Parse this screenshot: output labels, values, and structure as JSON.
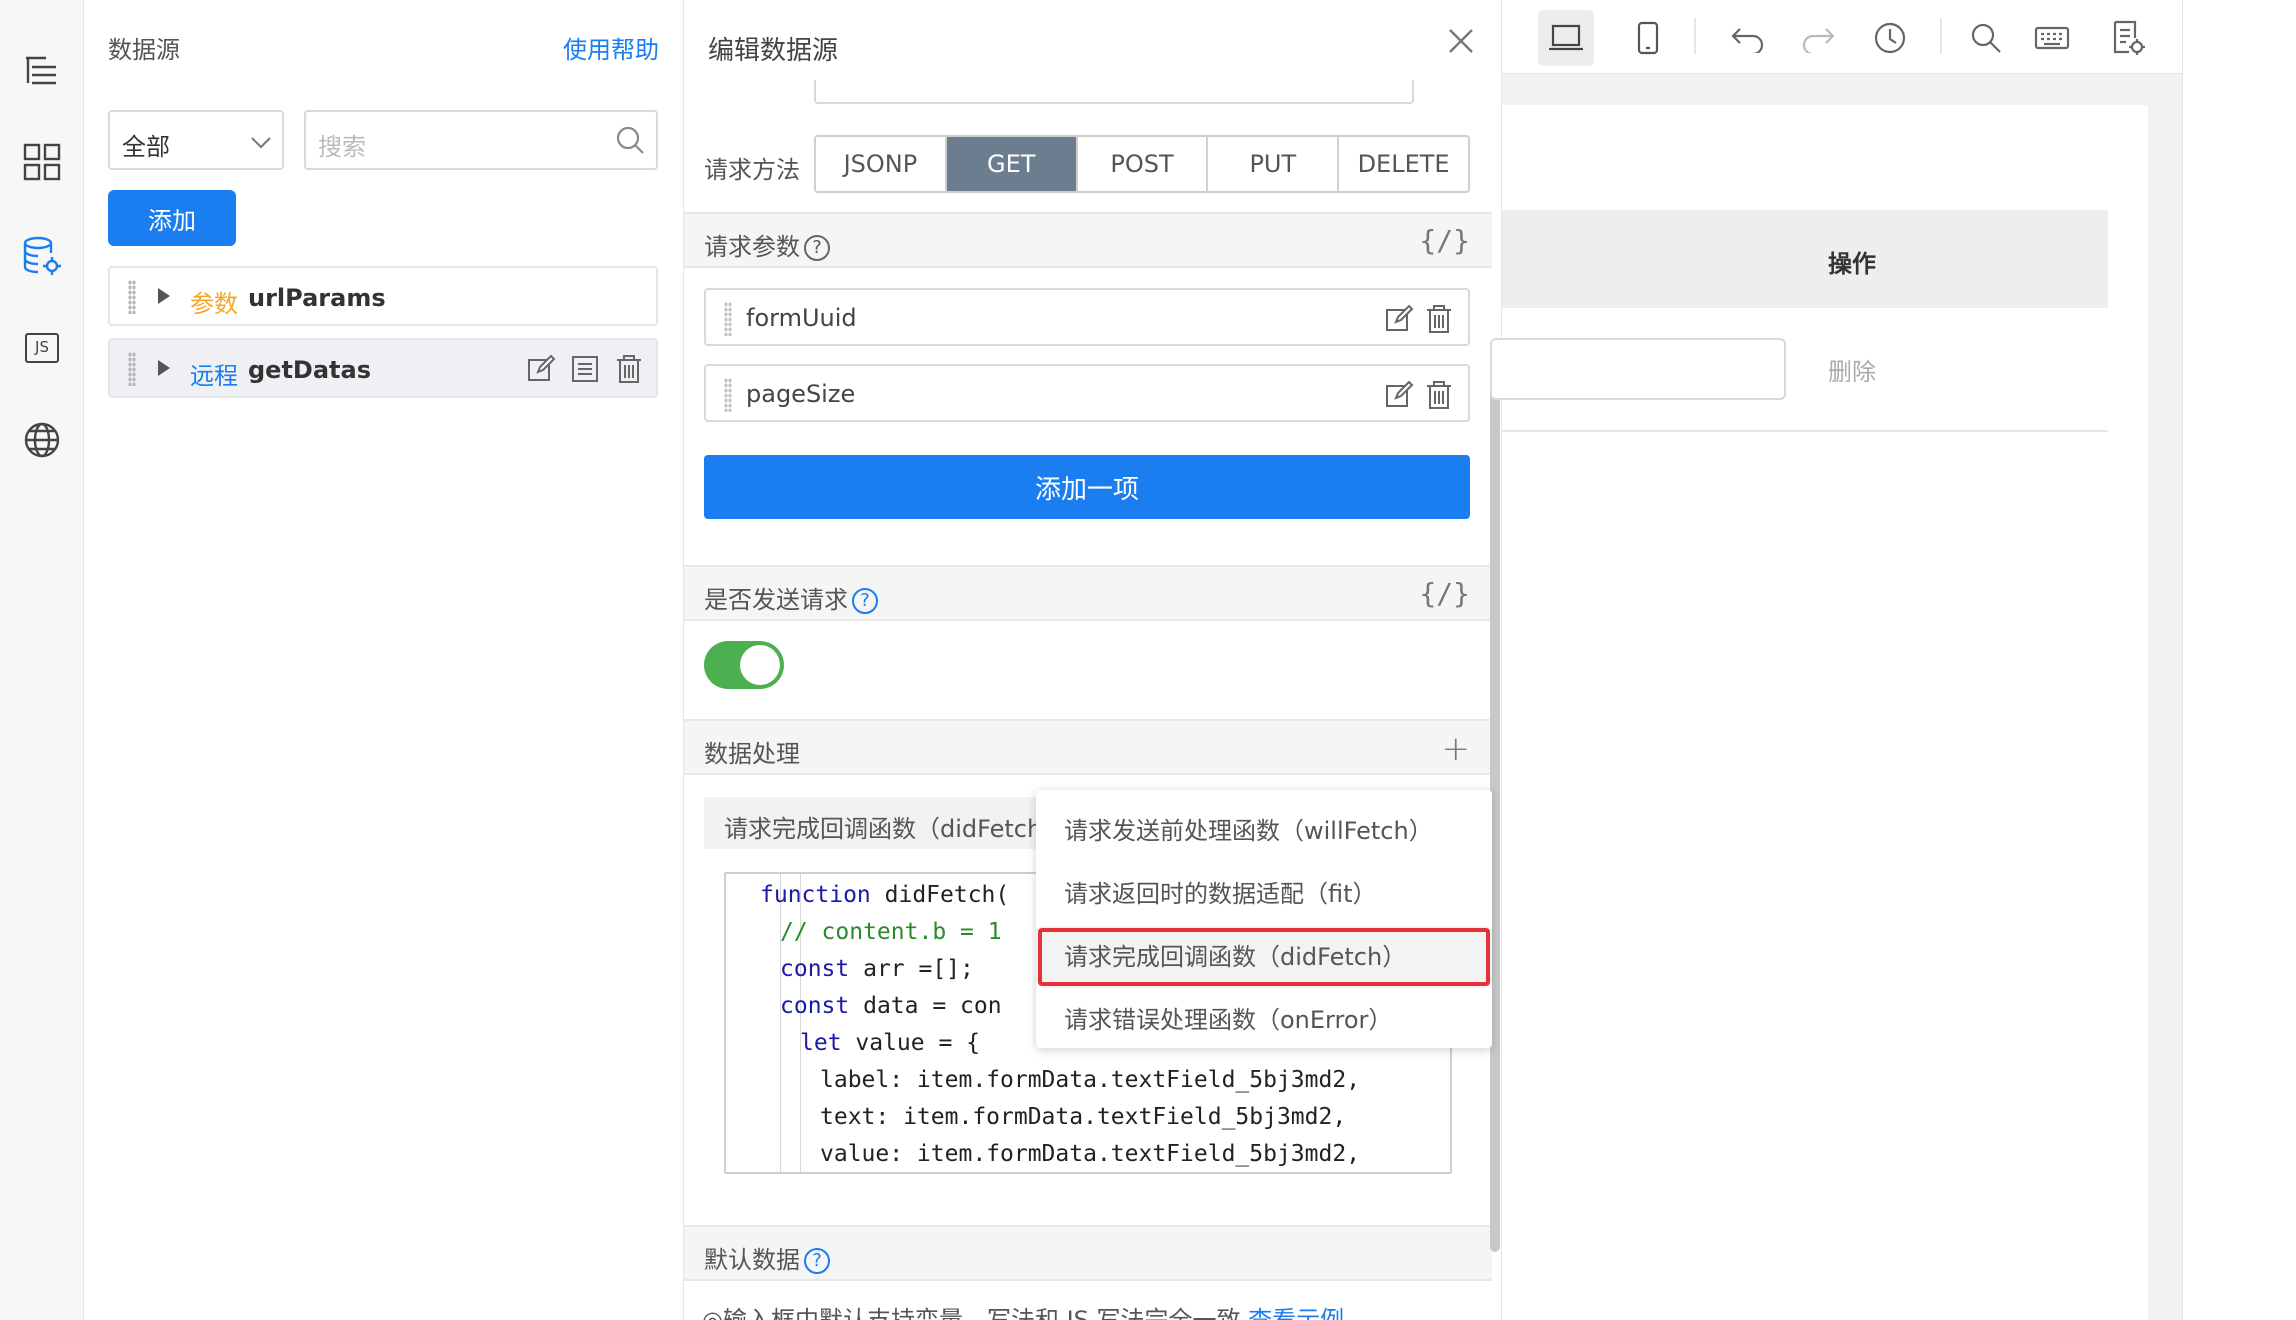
{
  "rail": {
    "icons": [
      "outline-icon",
      "components-icon",
      "datasource-icon",
      "js-icon",
      "globe-icon"
    ],
    "js_label": "JS"
  },
  "datasource": {
    "title": "数据源",
    "help_link": "使用帮助",
    "filter_value": "全部",
    "search_placeholder": "搜索",
    "add_button": "添加",
    "items": [
      {
        "kind": "参数",
        "name": "urlParams",
        "kind_color": "#f5a623"
      },
      {
        "kind": "远程",
        "name": "getDatas",
        "kind_color": "#1a7df0"
      }
    ]
  },
  "editor": {
    "title": "编辑数据源",
    "method_label": "请求方法",
    "methods": [
      "JSONP",
      "GET",
      "POST",
      "PUT",
      "DELETE"
    ],
    "selected_method": "GET",
    "params_label": "请求参数",
    "brace_symbol": "{/}",
    "params": [
      "formUuid",
      "pageSize"
    ],
    "add_item_button": "添加一项",
    "send_request_label": "是否发送请求",
    "send_request_enabled": true,
    "data_processing_label": "数据处理",
    "callback_tab": "请求完成回调函数（didFetch",
    "code_lines": [
      {
        "indent": 1,
        "parts": [
          [
            "kw",
            "function"
          ],
          [
            "",
            " didFetch("
          ]
        ]
      },
      {
        "indent": 2,
        "parts": [
          [
            "cm",
            "// content.b = 1"
          ]
        ]
      },
      {
        "indent": 2,
        "parts": [
          [
            "kw",
            "const"
          ],
          [
            "",
            " arr =[];"
          ]
        ]
      },
      {
        "indent": 2,
        "parts": [
          [
            "kw",
            "const"
          ],
          [
            "",
            " data = con"
          ]
        ]
      },
      {
        "indent": 3,
        "parts": [
          [
            "kw",
            "let"
          ],
          [
            "",
            " value = {"
          ]
        ]
      },
      {
        "indent": 4,
        "parts": [
          [
            "",
            "label: item.formData.textField_5bj3md2,"
          ]
        ]
      },
      {
        "indent": 4,
        "parts": [
          [
            "",
            "text: item.formData.textField_5bj3md2,"
          ]
        ]
      },
      {
        "indent": 4,
        "parts": [
          [
            "",
            "value: item.formData.textField_5bj3md2,"
          ]
        ]
      }
    ],
    "default_data_label": "默认数据",
    "default_note": "◎输入框中默认支持变量，写法和 JS 写法完全一致",
    "default_note_link": "查看示例"
  },
  "dropdown": {
    "options": [
      "请求发送前处理函数（willFetch）",
      "请求返回时的数据适配（fit）",
      "请求完成回调函数（didFetch）",
      "请求错误处理函数（onError）"
    ],
    "highlighted_index": 2,
    "highlight_color": "#e5323a"
  },
  "toolbar": {
    "icons": [
      "desktop-icon",
      "mobile-icon",
      "undo-icon",
      "redo-icon",
      "history-icon",
      "search-icon",
      "keyboard-icon",
      "page-settings-icon"
    ]
  },
  "canvas": {
    "column_header": "操作",
    "delete_link": "删除"
  }
}
